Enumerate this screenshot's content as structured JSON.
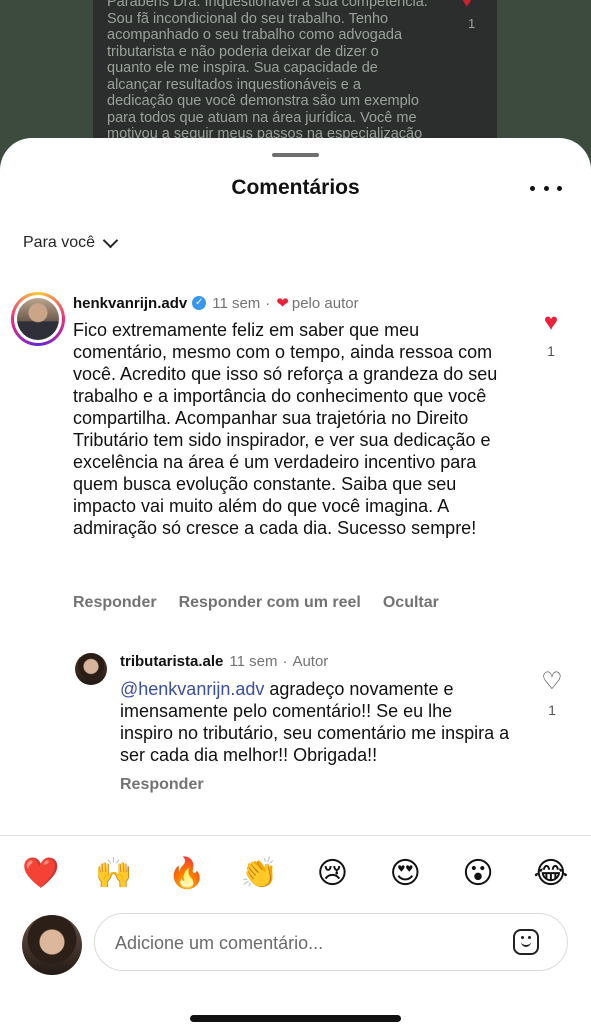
{
  "background_post": {
    "lines": [
      "Parabéns Dra. Inquestionável a sua competência.",
      "Sou fã incondicional do seu trabalho. Tenho",
      "acompanhado o seu trabalho como advogada",
      "tributarista e não poderia deixar de dizer o",
      "quanto ele me inspira. Sua capacidade de",
      "alcançar resultados inquestionáveis e a",
      "dedicação que você demonstra  são um exemplo",
      "para todos que atuam na área jurídica. Você me",
      "motivou a seguir meus passos na especialização"
    ],
    "like_count": "1"
  },
  "sheet": {
    "title": "Comentários",
    "filter_label": "Para você"
  },
  "comment": {
    "username": "henkvanrijn.adv",
    "time": "11 sem",
    "dot": "·",
    "liked_by_author": "pelo autor",
    "text": "Fico extremamente feliz em saber que meu comentário, mesmo com o tempo, ainda ressoa com você. Acredito que isso só reforça a grandeza do seu trabalho e a importância do conhecimento que você compartilha. Acompanhar sua trajetória no Direito Tributário tem sido inspirador, e ver sua dedicação e excelência na área é um verdadeiro incentivo para quem busca evolução constante. Saiba que seu impacto vai muito além do que você imagina. A admiração só cresce a cada dia. Sucesso sempre!",
    "like_count": "1",
    "actions": {
      "reply": "Responder",
      "reply_reel": "Responder com um reel",
      "hide": "Ocultar"
    }
  },
  "reply": {
    "username": "tributarista.ale",
    "time": "11 sem",
    "dot": "·",
    "author_tag": "Autor",
    "mention": "@henkvanrijn.adv",
    "text": " agradeço novamente e imensamente pelo comentário!! Se eu lhe inspiro no tributário, seu comentário me inspira a ser cada dia melhor!! Obrigada!!",
    "like_count": "1",
    "reply_action": "Responder"
  },
  "reactions": [
    "❤️",
    "🙌",
    "🔥",
    "👏",
    "😢",
    "😍",
    "😮",
    "😂"
  ],
  "composer": {
    "placeholder": "Adicione um comentário..."
  },
  "colors": {
    "like_red": "#ed1f39",
    "verified_blue": "#3897f0",
    "mention_blue": "#3a4ea3"
  }
}
